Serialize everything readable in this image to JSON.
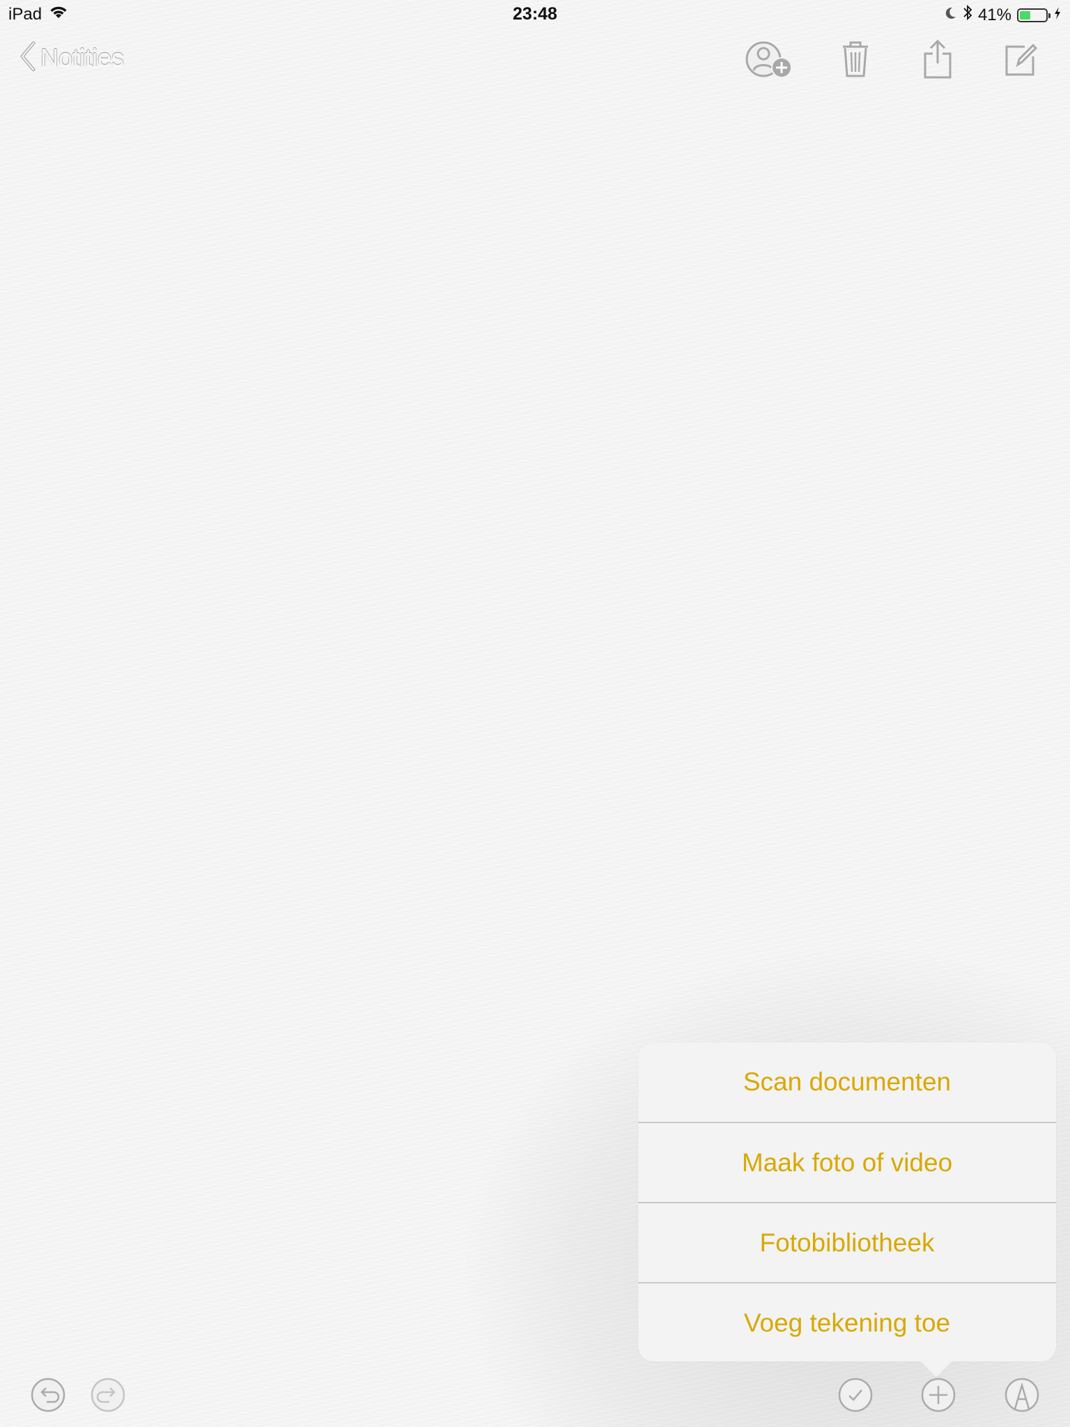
{
  "status_bar": {
    "device": "iPad",
    "time": "23:48",
    "battery_percent": "41%",
    "battery_level": 0.41,
    "icons": [
      "wifi-icon",
      "moon-icon",
      "bluetooth-icon",
      "battery-icon",
      "charging-icon"
    ]
  },
  "nav": {
    "back_label": "Notities",
    "icons": [
      "add-person-icon",
      "trash-icon",
      "share-icon",
      "compose-icon"
    ]
  },
  "popover": {
    "items": [
      {
        "label": "Scan documenten"
      },
      {
        "label": "Maak foto of video"
      },
      {
        "label": "Fotobibliotheek"
      },
      {
        "label": "Voeg tekening toe"
      }
    ]
  },
  "toolbar": {
    "icons": [
      "undo-icon",
      "redo-icon",
      "checklist-icon",
      "plus-icon",
      "markup-icon"
    ]
  },
  "colors": {
    "accent": "#d9a800",
    "battery_fill": "#4cd964",
    "background": "#f4f4f4",
    "embossed_icon": "#a8a8a8"
  }
}
